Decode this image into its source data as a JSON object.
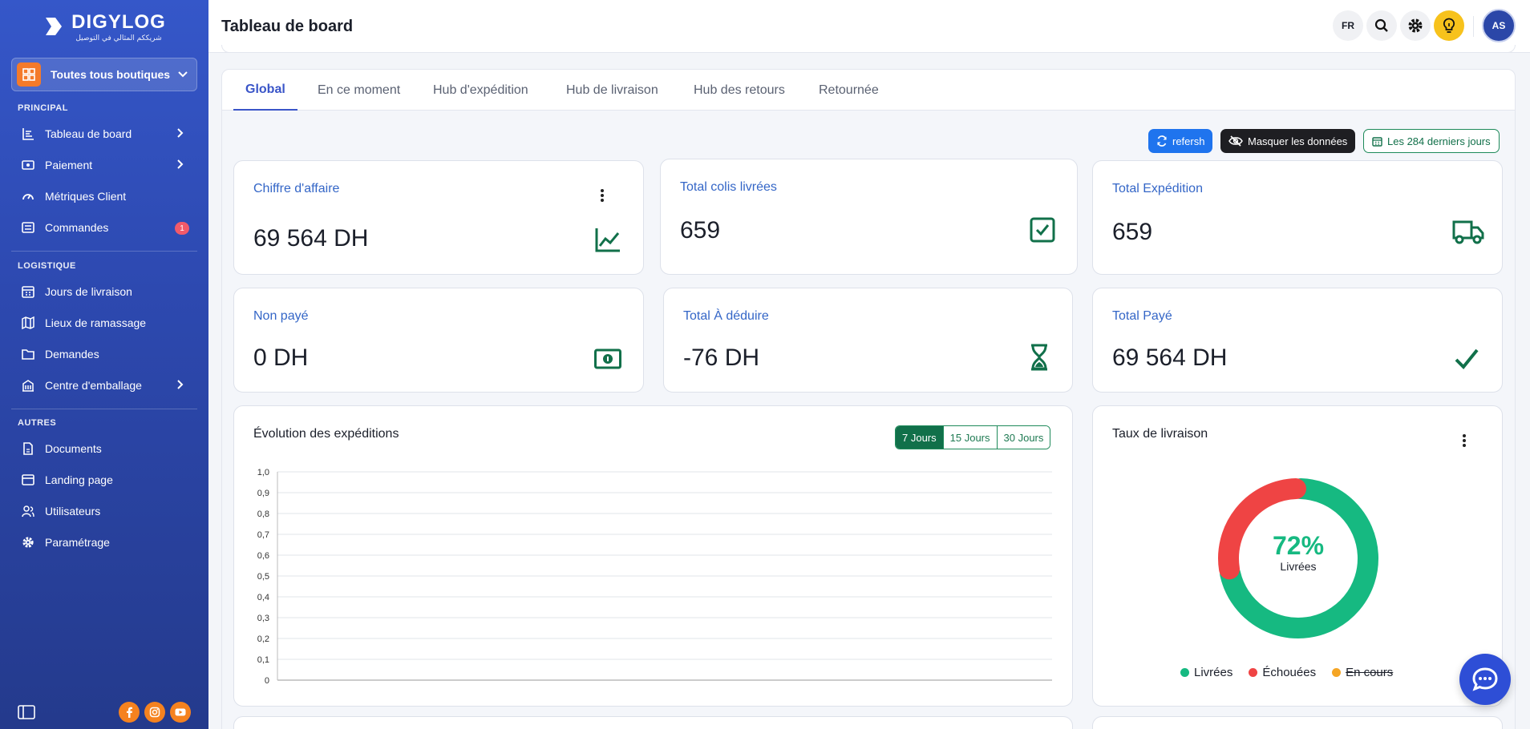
{
  "sidebar": {
    "brand": "DIGYLOG",
    "brand_tagline": "شريككم المثالي في التوصيل",
    "store_select": "Toutes tous boutiques",
    "sections": {
      "principal": "PRINCIPAL",
      "logistique": "LOGISTIQUE",
      "autres": "AUTRES"
    },
    "items": {
      "tableau": "Tableau de board",
      "paiement": "Paiement",
      "metriques": "Métriques Client",
      "commandes": "Commandes",
      "commandes_badge": "1",
      "jours": "Jours de livraison",
      "lieux": "Lieux de ramassage",
      "demandes": "Demandes",
      "centre": "Centre d'emballage",
      "documents": "Documents",
      "landing": "Landing page",
      "utilisateurs": "Utilisateurs",
      "parametrage": "Paramétrage"
    }
  },
  "header": {
    "title": "Tableau de board",
    "lang": "FR",
    "avatar": "AS"
  },
  "tabs": [
    "Global",
    "En ce moment",
    "Hub d'expédition",
    "Hub de livraison",
    "Hub des retours",
    "Retournée"
  ],
  "actions": {
    "refresh": "refersh",
    "hide": "Masquer les données",
    "period": "Les 284 derniers jours"
  },
  "stats": {
    "ca_label": "Chiffre d'affaire",
    "ca_value": "69 564 DH",
    "colis_label": "Total colis livrées",
    "colis_value": "659",
    "exp_label": "Total Expédition",
    "exp_value": "659",
    "nonpaye_label": "Non payé",
    "nonpaye_value": "0 DH",
    "deduire_label": "Total À déduire",
    "deduire_value": "-76 DH",
    "paye_label": "Total Payé",
    "paye_value": "69 564 DH"
  },
  "evolution": {
    "title": "Évolution des expéditions",
    "ranges": [
      "7 Jours",
      "15 Jours",
      "30 Jours"
    ],
    "selected_range": "7 Jours"
  },
  "taux": {
    "title": "Taux de livraison",
    "center_value": "72%",
    "center_label": "Livrées",
    "legend": [
      "Livrées",
      "Échouées",
      "En cours"
    ]
  },
  "chart_data": [
    {
      "type": "line",
      "title": "Évolution des expéditions",
      "ylim": [
        0,
        1
      ],
      "yticks": [
        "0",
        "0,1",
        "0,2",
        "0,3",
        "0,4",
        "0,5",
        "0,6",
        "0,7",
        "0,8",
        "0,9",
        "1,0"
      ],
      "series": [],
      "grid": true
    },
    {
      "type": "pie",
      "title": "Taux de livraison",
      "categories": [
        "Livrées",
        "Échouées",
        "En cours"
      ],
      "values": [
        72,
        28,
        0
      ],
      "colors": [
        "#16b981",
        "#ef4444",
        "#f5a524"
      ],
      "hidden": [
        "En cours"
      ]
    }
  ],
  "colors": {
    "primary": "#3a55c8",
    "green": "#11704a",
    "livrees": "#16b981",
    "echouees": "#ef4444",
    "encours": "#f5a524"
  }
}
